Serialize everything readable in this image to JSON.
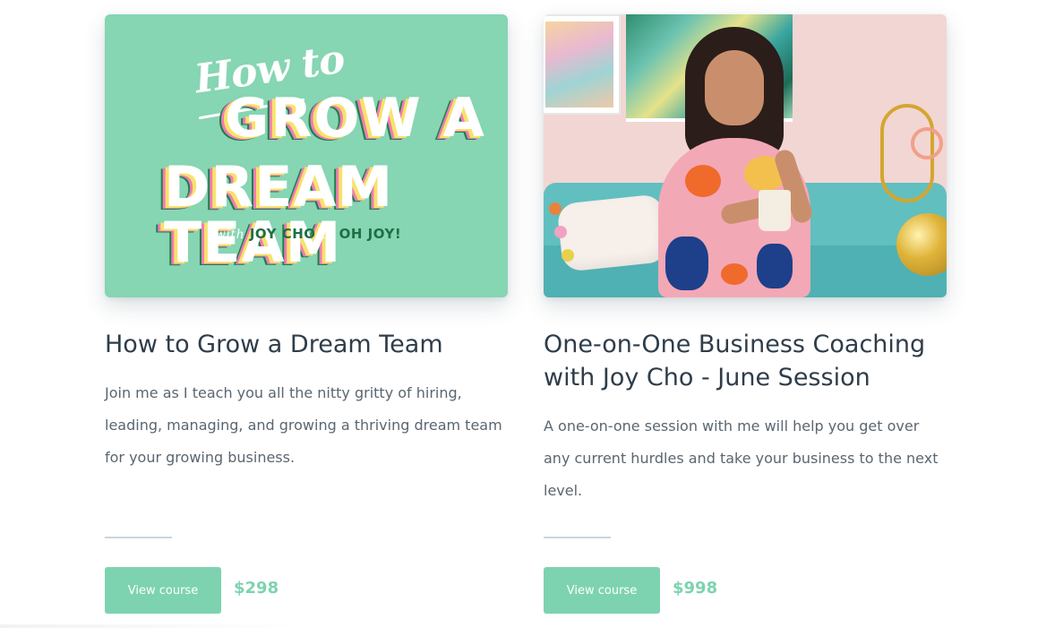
{
  "courses": [
    {
      "thumbnail": {
        "script_text": "How to",
        "line1": "GROW A",
        "line2": "DREAM TEAM",
        "with_word": "with",
        "author": "JOY CHO",
        "of_word": "of",
        "brand": "OH JOY!",
        "background": "#86d5b3"
      },
      "title": "How to Grow a Dream Team",
      "description": "Join me as I teach you all the nitty gritty of hiring, leading, managing, and growing a thriving dream team for your growing business.",
      "button_label": "View course",
      "price": "$298"
    },
    {
      "thumbnail": {
        "image": "photo-of-woman-on-sofa-with-mug",
        "background": "#f2d6d3"
      },
      "title": "One-on-One Business Coaching with Joy Cho - June Session",
      "description": "A one-on-one session with me will help you get over any current hurdles and take your business to the next level.",
      "button_label": "View course",
      "price": "$998"
    }
  ],
  "colors": {
    "accent": "#7dd3b0",
    "title": "#2f3d4a",
    "body_text": "#5a6670",
    "divider": "#c8d6de"
  }
}
